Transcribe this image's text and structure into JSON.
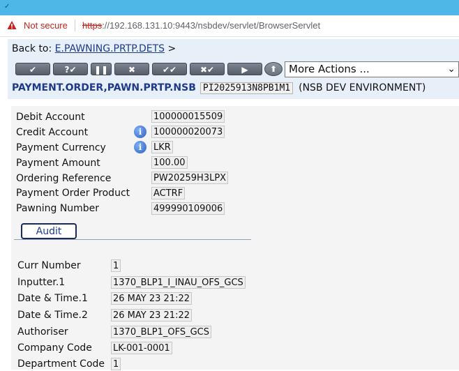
{
  "browser": {
    "security_label": "Not secure",
    "url_scheme": "https",
    "url_rest": "://192.168.131.10:9443/nsbdev/servlet/BrowserServlet"
  },
  "header": {
    "back_label": "Back to:",
    "back_link": "E.PAWNING.PRTP.DETS",
    "back_suffix": ">",
    "more_actions": "More Actions ...",
    "application": "PAYMENT.ORDER,PAWN.PRTP.NSB",
    "record_id": "PI2025913N8PB1M1",
    "environment": "(NSB DEV ENVIRONMENT)"
  },
  "toolbar": {
    "buttons": [
      "validate",
      "validate-commit",
      "hold",
      "delete",
      "authorise",
      "reverse",
      "next",
      "context"
    ]
  },
  "fields": [
    {
      "label": "Debit Account",
      "value": "100000015509",
      "info": false
    },
    {
      "label": "Credit Account",
      "value": "100000020073",
      "info": true
    },
    {
      "label": "Payment Currency",
      "value": "LKR",
      "info": true
    },
    {
      "label": "Payment Amount",
      "value": "100.00",
      "info": false
    },
    {
      "label": "Ordering Reference",
      "value": "PW20259H3LPX",
      "info": false
    },
    {
      "label": "Payment Order Product",
      "value": "ACTRF",
      "info": false
    },
    {
      "label": "Pawning Number",
      "value": "499990109006",
      "info": false
    }
  ],
  "audit": {
    "tab_label": "Audit",
    "fields": [
      {
        "label": "Curr Number",
        "value": "1"
      },
      {
        "label": "Inputter.1",
        "value": "1370_BLP1_I_INAU_OFS_GCS"
      },
      {
        "label": "Date & Time.1",
        "value": "26 MAY 23 21:22"
      },
      {
        "label": "Date & Time.2",
        "value": "26 MAY 23 21:22"
      },
      {
        "label": "Authoriser",
        "value": "1370_BLP1_OFS_GCS"
      },
      {
        "label": "Company Code",
        "value": "LK-001-0001"
      },
      {
        "label": "Department Code",
        "value": "1"
      }
    ]
  },
  "colors": {
    "link": "#1f3a8a",
    "header_bg": "#e7f0f8",
    "chrome": "#4fb7e8",
    "warning": "#c5221f"
  }
}
